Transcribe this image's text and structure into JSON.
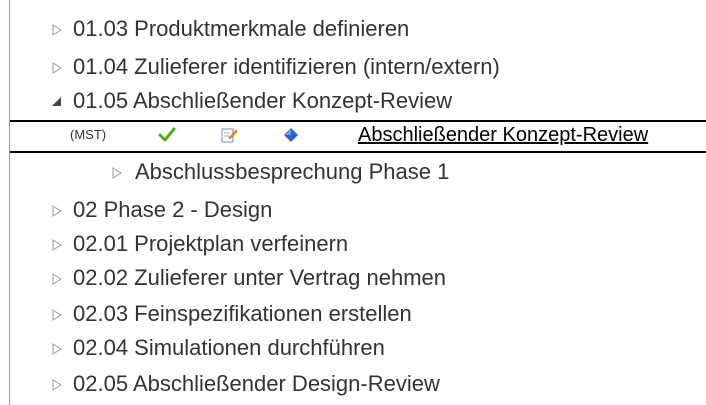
{
  "tree": {
    "rows": [
      {
        "label": "01.03 Produktmerkmale definieren",
        "state": "collapsed"
      },
      {
        "label": "01.04 Zulieferer identifizieren (intern/extern)",
        "state": "collapsed"
      },
      {
        "label": "01.05 Abschließender Konzept-Review",
        "state": "expanded"
      },
      {
        "label": "Abschlussbesprechung Phase 1",
        "state": "collapsed"
      },
      {
        "label": "02 Phase 2 - Design",
        "state": "collapsed"
      },
      {
        "label": "02.01 Projektplan verfeinern",
        "state": "collapsed"
      },
      {
        "label": "02.02 Zulieferer unter Vertrag nehmen",
        "state": "collapsed"
      },
      {
        "label": "02.03 Feinspezifikationen erstellen",
        "state": "collapsed"
      },
      {
        "label": "02.04 Simulationen durchführen",
        "state": "collapsed"
      },
      {
        "label": "02.05 Abschließender Design-Review",
        "state": "collapsed"
      }
    ],
    "selected_task": {
      "type": "(MST)",
      "name": "Abschließender Konzept-Review",
      "icons": [
        "checkmark-icon",
        "edit-icon",
        "diamond-milestone-icon"
      ]
    }
  },
  "colors": {
    "text": "#333333",
    "triangle": "#9a9a9a",
    "check_green": "#4caf1a",
    "diamond_blue": "#2a62c9"
  }
}
